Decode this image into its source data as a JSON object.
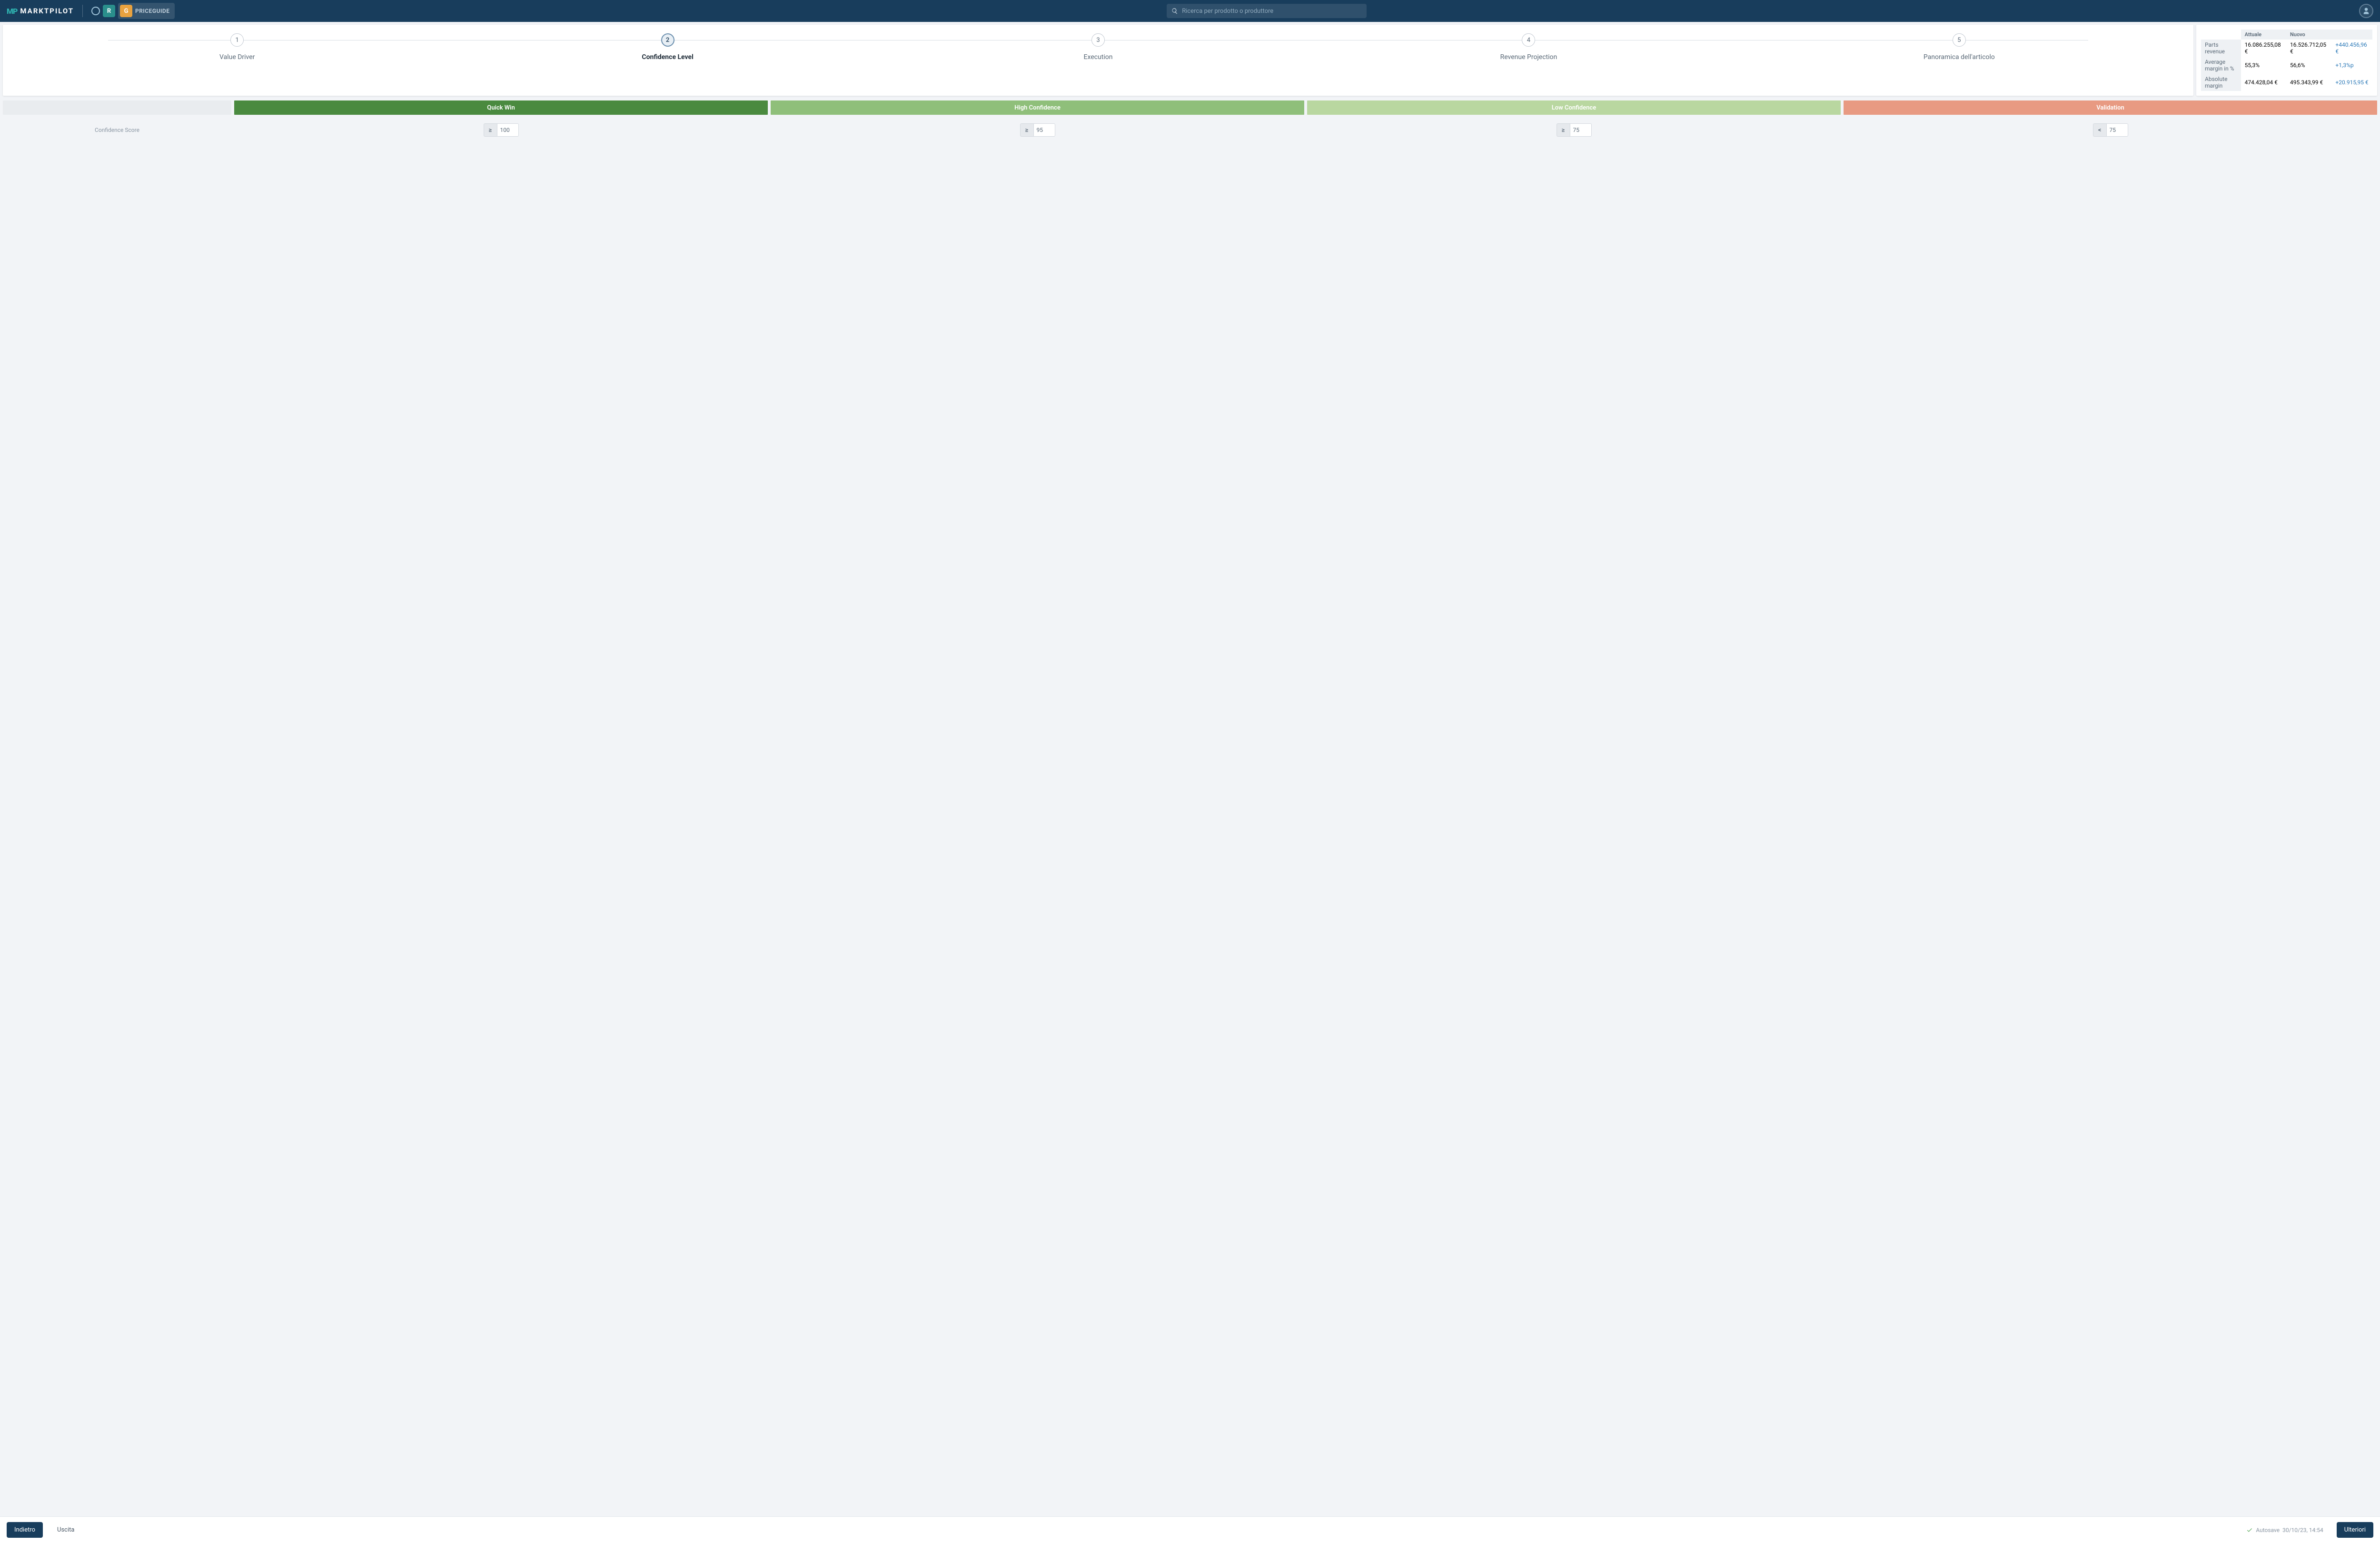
{
  "header": {
    "brand_prefix": "MP",
    "brand_text": "MARKTPILOT",
    "tool_r_label": "R",
    "tool_g_label": "G",
    "priceguide_label": "PRICEGUIDE",
    "search_placeholder": "Ricerca per prodotto o produttore"
  },
  "steps": [
    {
      "num": "1",
      "label": "Value Driver"
    },
    {
      "num": "2",
      "label": "Confidence Level"
    },
    {
      "num": "3",
      "label": "Execution"
    },
    {
      "num": "4",
      "label": "Revenue Projection"
    },
    {
      "num": "5",
      "label": "Panoramica dell'articolo"
    }
  ],
  "active_step_index": 1,
  "summary": {
    "col_current": "Attuale",
    "col_new": "Nuovo",
    "rows": [
      {
        "metric": "Parts revenue",
        "current": "16.086.255,08 €",
        "new": "16.526.712,05 €",
        "delta": "+440.456,96 €"
      },
      {
        "metric": "Average margin in %",
        "current": "55,3%",
        "new": "56,6%",
        "delta": "+1,3%p"
      },
      {
        "metric": "Absolute margin",
        "current": "474.428,04 €",
        "new": "495.343,99 €",
        "delta": "+20.915,95 €"
      }
    ]
  },
  "confidence": {
    "row_label": "Confidence Score",
    "columns": [
      {
        "key": "quick_win",
        "label": "Quick Win",
        "op": "≥",
        "val": "100"
      },
      {
        "key": "high_conf",
        "label": "High Confidence",
        "op": "≥",
        "val": "95"
      },
      {
        "key": "low_conf",
        "label": "Low Confidence",
        "op": "≥",
        "val": "75"
      },
      {
        "key": "validation",
        "label": "Validation",
        "op": "<",
        "val": "75"
      }
    ]
  },
  "footer": {
    "back": "Indietro",
    "exit": "Uscita",
    "autosave_prefix": "Autosave",
    "autosave_ts": "30/10/23, 14:54",
    "next": "Ulteriori"
  }
}
